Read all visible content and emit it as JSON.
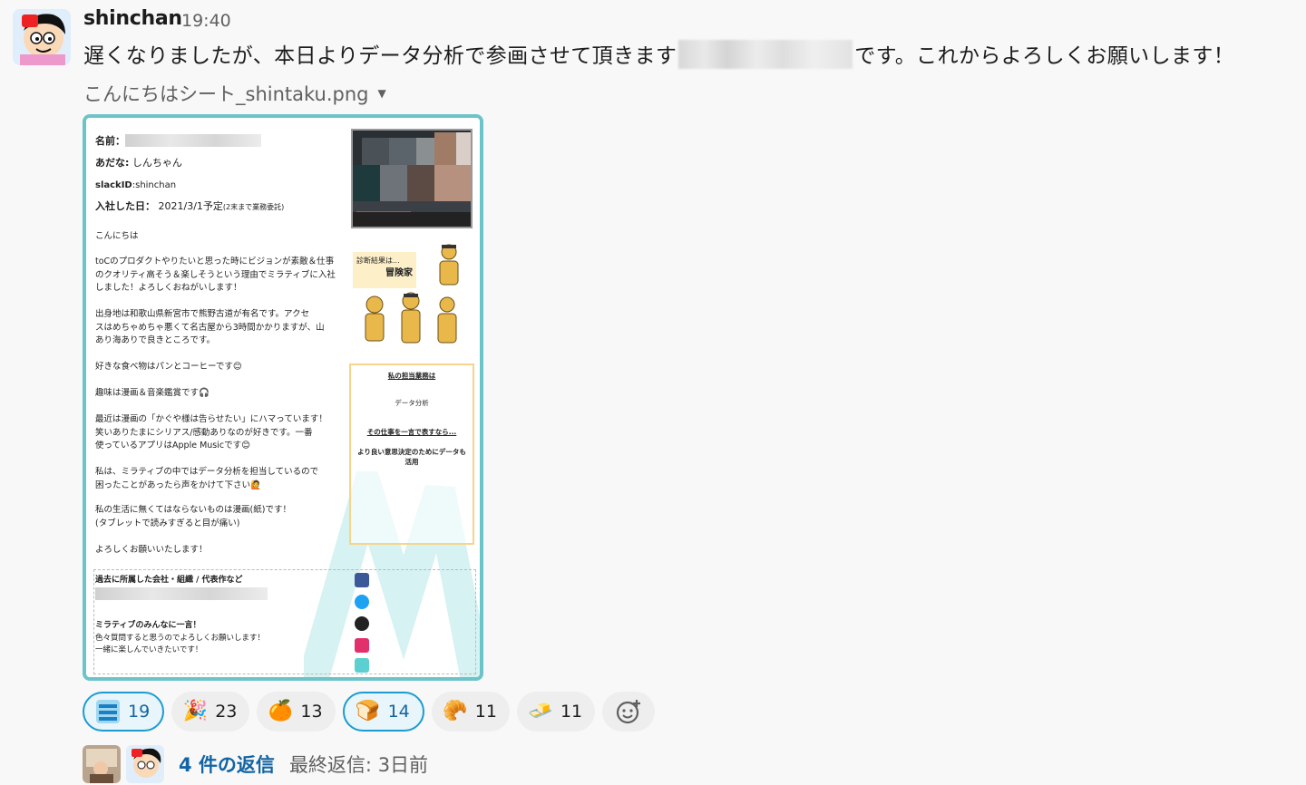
{
  "message": {
    "author": "shinchan",
    "time": "19:40",
    "text_before": "遅くなりましたが、本日よりデータ分析で参画させて頂きます",
    "text_after": "です。これからよろしくお願いします！"
  },
  "file": {
    "name": "こんにちはシート_shintaku.png"
  },
  "sheet": {
    "name_label": "名前：",
    "nickname_label": "あだな:",
    "nickname_value": "しんちゃん",
    "slack_label": "slackID",
    "slack_value": ":shinchan",
    "join_label": "入社した日：",
    "join_value": "2021/3/1予定",
    "join_note": "(2末まで業務委託)",
    "greeting": "こんにちは",
    "para1": "toCのプロダクトやりたいと思った時にビジョンが素敵＆仕事\nのクオリティ高そう＆楽しそうという理由でミラティブに入社\nしました！よろしくおねがいします！",
    "para2": "出身地は和歌山県新宮市で熊野古道が有名です。アクセ\nスはめちゃめちゃ悪くて名古屋から3時間かかりますが、山\nあり海ありで良きところです。",
    "para3": "好きな食べ物はパンとコーヒーです😊",
    "para4": "趣味は漫画＆音楽鑑賞です🎧",
    "para5": "最近は漫画の「かぐや様は告らせたい」にハマっています！\n笑いありたまにシリアス/感動ありなのが好きです。一番\n使っているアプリはApple Musicです😊",
    "para6": "私は、ミラティブの中ではデータ分析を担当しているので\n困ったことがあったら声をかけて下さい🙋",
    "para7": "私の生活に無くてはならないものは漫画(紙)です！\n(タブレットで読みすぎると目が痛い)",
    "para8": "よろしくお願いいたします！",
    "diagnosis_label": "診断結果は...",
    "diagnosis_value": "冒険家",
    "work_title": "私の担当業務は",
    "work_value": "データ分析",
    "work_sub": "その仕事を一言で表すなら...",
    "work_desc": "より良い意思決定のためにデータも活用",
    "past_title": "過去に所属した会社・組織 / 代表作など",
    "message_title": "ミラティブのみんなに一言！",
    "message_body": "色々質問すると思うのでよろしくお願いします！\n一緒に楽しんでいきたいです！"
  },
  "reactions": [
    {
      "emoji": "yoroshiku-icon",
      "count": "19",
      "active": true
    },
    {
      "emoji": "party-popper-icon",
      "glyph": "🎉",
      "count": "23",
      "active": false
    },
    {
      "emoji": "tangerine-icon",
      "glyph": "🍊",
      "count": "13",
      "active": false
    },
    {
      "emoji": "bread-icon",
      "glyph": "🍞",
      "count": "14",
      "active": true
    },
    {
      "emoji": "croissant-icon",
      "glyph": "🥐",
      "count": "11",
      "active": false
    },
    {
      "emoji": "butter-icon",
      "glyph": "🧈",
      "count": "11",
      "active": false
    }
  ],
  "thread": {
    "replies": "4 件の返信",
    "last_reply": "最終返信: 3日前"
  },
  "colors": {
    "link": "#1264a3",
    "frame": "#6cc4c9",
    "active_reaction_border": "#1d9bd1"
  }
}
